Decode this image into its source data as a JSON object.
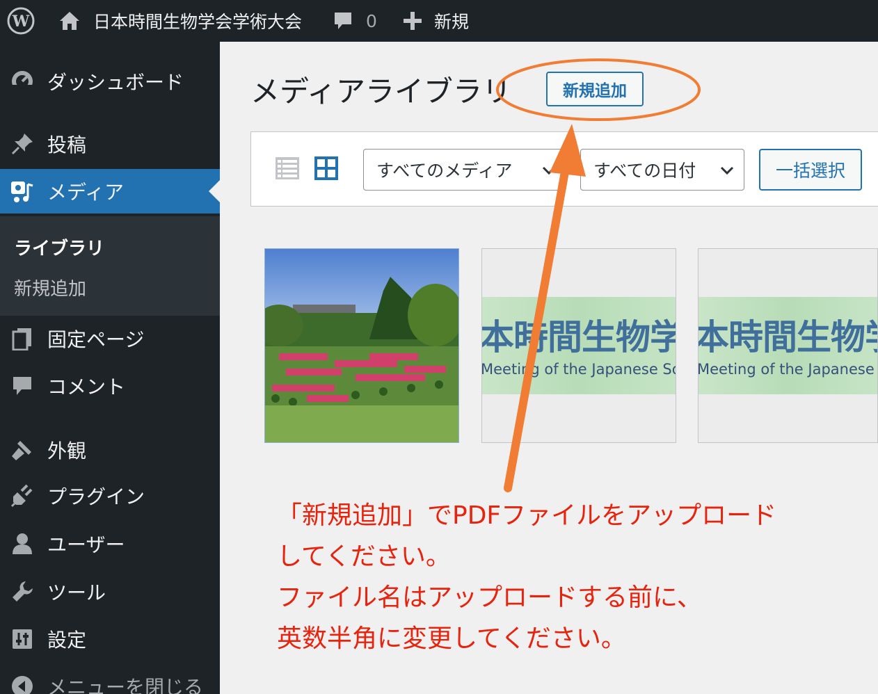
{
  "adminbar": {
    "site_name": "日本時間生物学会学術大会",
    "comments_count": "0",
    "new_label": "新規"
  },
  "sidebar": {
    "items": [
      {
        "label": "ダッシュボード",
        "icon": "dashboard-icon"
      },
      {
        "label": "投稿",
        "icon": "pin-icon"
      },
      {
        "label": "メディア",
        "icon": "media-icon"
      },
      {
        "label": "固定ページ",
        "icon": "pages-icon"
      },
      {
        "label": "コメント",
        "icon": "comment-icon"
      },
      {
        "label": "外観",
        "icon": "brush-icon"
      },
      {
        "label": "プラグイン",
        "icon": "plugin-icon"
      },
      {
        "label": "ユーザー",
        "icon": "user-icon"
      },
      {
        "label": "ツール",
        "icon": "wrench-icon"
      },
      {
        "label": "設定",
        "icon": "settings-icon"
      },
      {
        "label": "メニューを閉じる",
        "icon": "collapse-icon"
      }
    ],
    "submenu": [
      "ライブラリ",
      "新規追加"
    ]
  },
  "main": {
    "title": "メディアライブラリ",
    "add_new": "新規追加",
    "filter_media": "すべてのメディア",
    "filter_date": "すべての日付",
    "bulk_select": "一括選択",
    "banner_title": "本時間生物学会",
    "banner_subtitle": "Meeting of the Japanese Society"
  },
  "annotation": {
    "lines": [
      "「新規追加」でPDFファイルをアップロード",
      "してください。",
      "ファイル名はアップロードする前に、",
      "英数半角に変更してください。"
    ],
    "color": "#e8230d",
    "highlight_color": "#f07d33"
  },
  "colors": {
    "admin_dark": "#1d2327",
    "accent": "#2271b1",
    "submenu_bg": "#2c3338"
  }
}
